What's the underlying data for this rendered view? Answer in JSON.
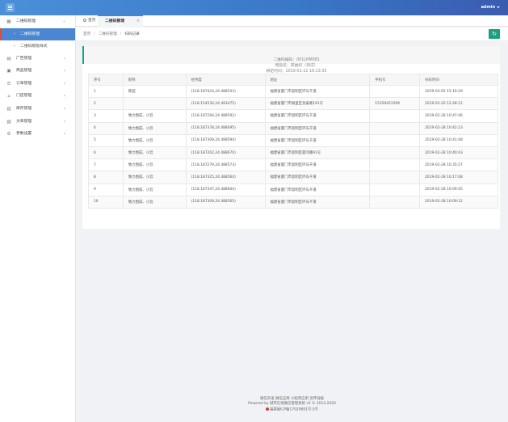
{
  "header": {
    "user": "admin"
  },
  "sidebar": {
    "items": [
      {
        "label": "二维码管理",
        "icon": "grid-icon",
        "open": true,
        "children": [
          {
            "label": "二维码管理",
            "active": true
          },
          {
            "label": "二维码模板样式",
            "active": false
          }
        ]
      },
      {
        "label": "广告管理",
        "icon": "ad-icon"
      },
      {
        "label": "商品管理",
        "icon": "goods-icon"
      },
      {
        "label": "订单管理",
        "icon": "order-icon"
      },
      {
        "label": "门店管理",
        "icon": "store-icon"
      },
      {
        "label": "库存管理",
        "icon": "stock-icon"
      },
      {
        "label": "文章管理",
        "icon": "article-icon"
      },
      {
        "label": "参数设置",
        "icon": "settings-icon"
      }
    ]
  },
  "tabs": {
    "home": "首页",
    "current": "二维码管理",
    "close": "×"
  },
  "breadcrumb": {
    "home": "首页",
    "parent": "二维码管理",
    "current": "扫码记录",
    "sep": "/"
  },
  "info": {
    "code": "二维码编码：001LHM081",
    "product": "物品名：邪益扣（测试）",
    "bind_time": "绑定时间：2019-01-22 19:13:35"
  },
  "table": {
    "columns": [
      "序号",
      "昵称",
      "经纬度",
      "地址",
      "手机号",
      "扫码时间"
    ],
    "rows": [
      [
        "1",
        "陈超",
        "(118.187424,24.488543)",
        "福建省厦门市思明区环岛干道",
        "",
        "2019-03-05 15:16:29"
      ],
      [
        "2",
        "",
        "(118.154530,24.493475)",
        "福建省厦门市湖里区金泰路191号",
        "15359451599",
        "2019-02-20 12:28:12"
      ],
      [
        "3",
        "致力围成、小云",
        "(118.187294,24.488592)",
        "福建省厦门市思明区环岛干道",
        "",
        "2019-02-28 10:47:46"
      ],
      [
        "4",
        "致力围成、小云",
        "(118.187378,24.488495)",
        "福建省厦门市思明区环岛干道",
        "",
        "2019-02-28 10:42:23"
      ],
      [
        "5",
        "致力围成、小云",
        "(118.187309,24.488594)",
        "福建省厦门市思明区环岛干道",
        "",
        "2019-02-28 10:41:48"
      ],
      [
        "6",
        "致力围成、小云",
        "(118.187202,24.488670)",
        "福建省厦门市思明区厦鸿路91号",
        "",
        "2019-02-28 10:40:43"
      ],
      [
        "7",
        "致力围成、小云",
        "(118.187279,24.488573)",
        "福建省厦门市思明区环岛干道",
        "",
        "2019-02-28 10:35:27"
      ],
      [
        "8",
        "致力围成、小云",
        "(118.187325,24.488564)",
        "福建省厦门市思明区环岛干道",
        "",
        "2019-02-28 10:17:08"
      ],
      [
        "9",
        "致力围成、小云",
        "(118.187347,24.488604)",
        "福建省厦门市思明区环岛干道",
        "",
        "2019-02-28 10:09:45"
      ],
      [
        "10",
        "致力围成、小云",
        "(118.187309,24.488565)",
        "福建省厦门市思明区环岛干道",
        "",
        "2019-02-28 10:09:12"
      ]
    ]
  },
  "footer": {
    "line1": "微信开发 微信应用 小程序应用 宣传海报",
    "line2": "Powered by 城市在线微信管理系统 v5 © 2014-2020",
    "line3": "福建闽ICP备17029891号-5号"
  },
  "colors": {
    "accent": "#4a86d1",
    "green": "#1aa385",
    "active_marker": "#e24a3b"
  }
}
